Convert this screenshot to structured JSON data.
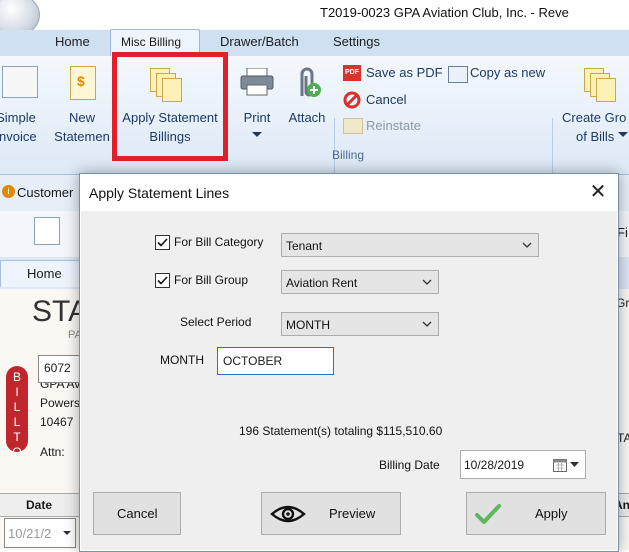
{
  "window": {
    "title": "T2019-0023 GPA Aviation Club, Inc. - Reve"
  },
  "ribbon_tabs": [
    "Home",
    "Misc Billing",
    "Drawer/Batch",
    "Settings"
  ],
  "ribbon": {
    "simple_invoice": [
      "Simple",
      "Invoice"
    ],
    "new_statement": [
      "New",
      "Statemen"
    ],
    "apply_statement_billings": [
      "Apply Statement",
      "Billings"
    ],
    "print": "Print",
    "attach": "Attach",
    "save_as_pdf": "Save as PDF",
    "copy_as_new": "Copy as new",
    "cancel": "Cancel",
    "reinstate": "Reinstate",
    "create_group_of_bills": [
      "Create Gro",
      "of Bills"
    ],
    "group_label": "Billing"
  },
  "background": {
    "customer_tab": "Customer",
    "home_tab": "Home",
    "fi_fragment": "Fi",
    "doc_title_fragment": "STA",
    "doc_sub_fragment": "PA",
    "gr_fragment": "Gr",
    "ta_fragment": "TA",
    "account_number": "6072",
    "bill_to_letters": [
      "B",
      "I",
      "L",
      "L",
      "T",
      "O"
    ],
    "address_lines": [
      "GPA Avi",
      "Powers",
      "10467"
    ],
    "attn_label": "Attn:",
    "date_header": "Date",
    "an_header": "An",
    "date_value": "10/21/2"
  },
  "dialog": {
    "title": "Apply Statement Lines",
    "bill_category": {
      "label": "For Bill Category",
      "checked": true,
      "value": "Tenant"
    },
    "bill_group": {
      "label": "For Bill Group",
      "checked": true,
      "value": "Aviation Rent"
    },
    "select_period": {
      "label": "Select Period",
      "value": "MONTH"
    },
    "month": {
      "label": "MONTH",
      "value": "OCTOBER"
    },
    "summary": "196 Statement(s) totaling $115,510.60",
    "billing_date": {
      "label": "Billing Date",
      "value": "10/28/2019"
    },
    "buttons": {
      "cancel": "Cancel",
      "preview": "Preview",
      "apply": "Apply"
    }
  },
  "colors": {
    "highlight_box": "#e0202a",
    "ribbon_bg": "#dde9f6",
    "apply_check": "#5cb85c"
  }
}
